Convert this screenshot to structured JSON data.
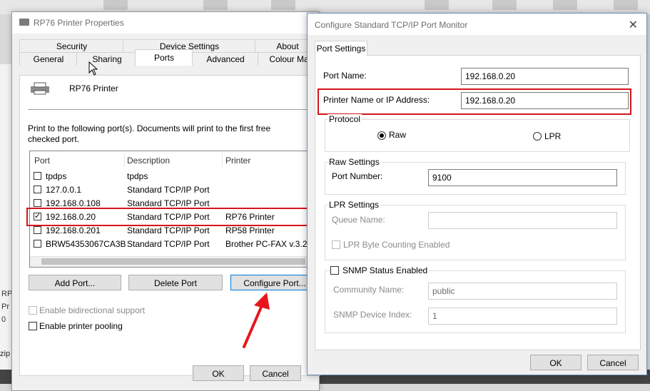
{
  "desktop": {
    "left_labels": [
      "RP",
      "Pr",
      "0"
    ],
    "zip_label": "zip"
  },
  "properties": {
    "title": "RP76 Printer Properties",
    "tabs_row1": [
      "Security",
      "Device Settings",
      "About"
    ],
    "tabs_row2": [
      "General",
      "Sharing",
      "Ports",
      "Advanced",
      "Colour Ma"
    ],
    "active_tab": "Ports",
    "printer_name": "RP76 Printer",
    "instructions": "Print to the following port(s). Documents will print to the first free checked port.",
    "columns": [
      "Port",
      "Description",
      "Printer"
    ],
    "ports": [
      {
        "checked": false,
        "port": "tpdps",
        "description": "tpdps",
        "printer": ""
      },
      {
        "checked": false,
        "port": "127.0.0.1",
        "description": "Standard TCP/IP Port",
        "printer": ""
      },
      {
        "checked": false,
        "port": "192.168.0.108",
        "description": "Standard TCP/IP Port",
        "printer": ""
      },
      {
        "checked": true,
        "port": "192.168.0.20",
        "description": "Standard TCP/IP Port",
        "printer": "RP76 Printer"
      },
      {
        "checked": false,
        "port": "192.168.0.201",
        "description": "Standard TCP/IP Port",
        "printer": "RP58 Printer"
      },
      {
        "checked": false,
        "port": "BRW54353067CA3B",
        "description": "Standard TCP/IP Port",
        "printer": "Brother PC-FAX v.3.2 ("
      }
    ],
    "add_port": "Add Port...",
    "delete_port": "Delete Port",
    "configure_port": "Configure Port...",
    "bidirectional": "Enable bidirectional support",
    "pooling": "Enable printer pooling",
    "ok": "OK",
    "cancel": "Cancel"
  },
  "config": {
    "title": "Configure Standard TCP/IP Port Monitor",
    "tab": "Port Settings",
    "port_name_label": "Port Name:",
    "port_name": "192.168.0.20",
    "address_label": "Printer Name or IP Address:",
    "address": "192.168.0.20",
    "protocol_label": "Protocol",
    "raw": "Raw",
    "lpr": "LPR",
    "protocol_selected": "Raw",
    "raw_settings": "Raw Settings",
    "port_number_label": "Port Number:",
    "port_number": "9100",
    "lpr_settings": "LPR Settings",
    "queue_name_label": "Queue Name:",
    "queue_name": "",
    "lpr_byte_counting": "LPR Byte Counting Enabled",
    "snmp_enabled": "SNMP Status Enabled",
    "community_label": "Community Name:",
    "community": "public",
    "device_index_label": "SNMP Device Index:",
    "device_index": "1",
    "ok": "OK",
    "cancel": "Cancel"
  },
  "colors": {
    "highlight": "#d4151b",
    "focus_border": "#0078d7"
  }
}
